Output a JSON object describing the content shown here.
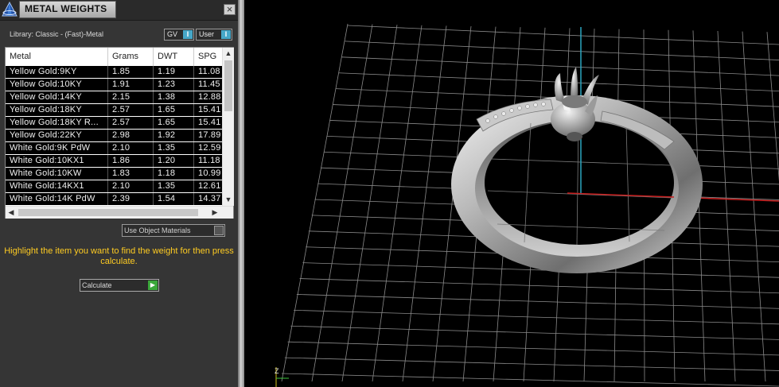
{
  "panel": {
    "title": "METAL WEIGHTS",
    "close_glyph": "×",
    "library_label": "Library: Classic - (Fast)-Metal",
    "gv_label": "GV",
    "user_label": "User",
    "use_object_materials_label": "Use Object Materials",
    "instruction": "Highlight the item you want to find the weight for then press calculate.",
    "calculate_label": "Calculate"
  },
  "table": {
    "columns": [
      "Metal",
      "Grams",
      "DWT",
      "SPG"
    ],
    "rows": [
      [
        "Yellow Gold:9KY",
        "1.85",
        "1.19",
        "11.08"
      ],
      [
        "Yellow Gold:10KY",
        "1.91",
        "1.23",
        "11.45"
      ],
      [
        "Yellow Gold:14KY",
        "2.15",
        "1.38",
        "12.88"
      ],
      [
        "Yellow Gold:18KY",
        "2.57",
        "1.65",
        "15.41"
      ],
      [
        "Yellow Gold:18KY R...",
        "2.57",
        "1.65",
        "15.41"
      ],
      [
        "Yellow Gold:22KY",
        "2.98",
        "1.92",
        "17.89"
      ],
      [
        "White Gold:9K PdW",
        "2.10",
        "1.35",
        "12.59"
      ],
      [
        "White Gold:10KX1",
        "1.86",
        "1.20",
        "11.18"
      ],
      [
        "White Gold:10KW",
        "1.83",
        "1.18",
        "10.99"
      ],
      [
        "White Gold:14KX1",
        "2.10",
        "1.35",
        "12.61"
      ],
      [
        "White Gold:14K PdW",
        "2.39",
        "1.54",
        "14.37"
      ]
    ]
  },
  "icons": {
    "app": "pyramid-logo-icon",
    "close": "close-icon",
    "scroll_up": "chevron-up-icon",
    "scroll_down": "chevron-down-icon",
    "scroll_left": "chevron-left-icon",
    "scroll_right": "chevron-right-icon",
    "calculate": "play-arrow-icon"
  },
  "viewport": {
    "axis_label": "Z",
    "x_axis_color": "#c81e1e",
    "y_axis_color": "#2aa6c0",
    "grid_color": "#8a8a8a"
  },
  "colors": {
    "instruction_text": "#ffcc22",
    "toggle_accent": "#46a7c8",
    "calculate_accent": "#3aa83a"
  }
}
